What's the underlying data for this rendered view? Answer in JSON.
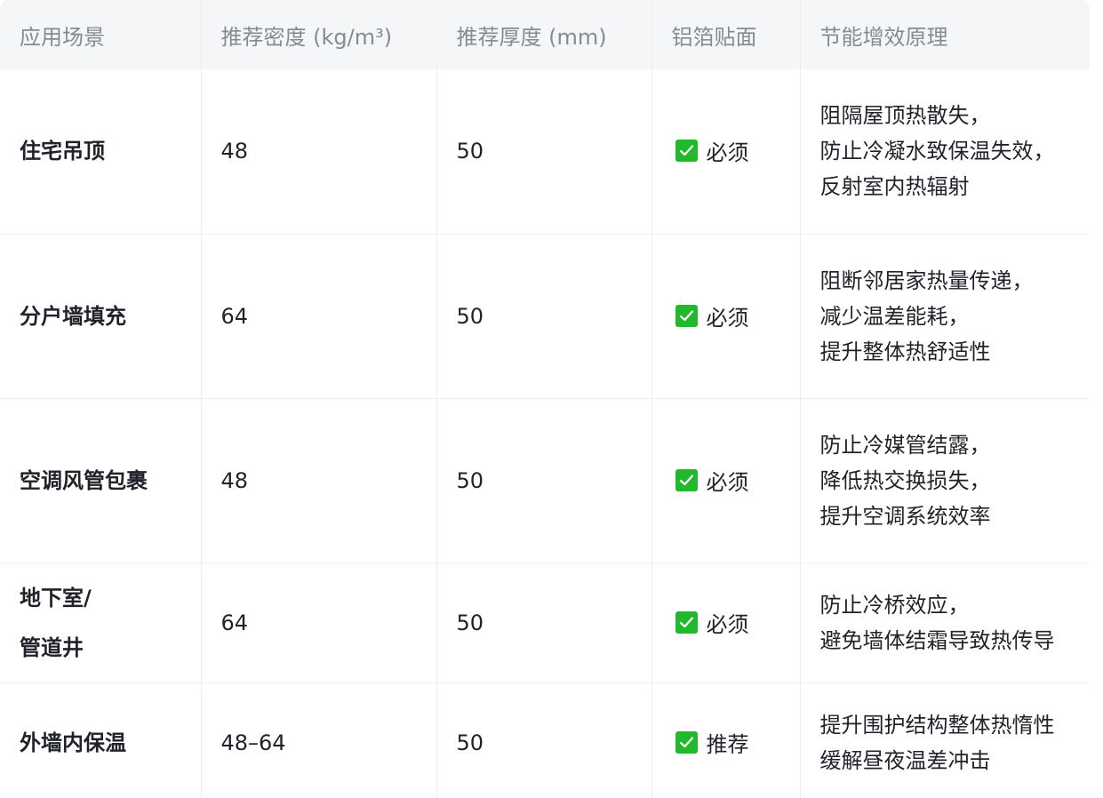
{
  "headers": {
    "scene": "应用场景",
    "density": "推荐密度 (kg/m³)",
    "thickness": "推荐厚度 (mm)",
    "foil": "铝箔贴面",
    "principle": "节能增效原理"
  },
  "rows": [
    {
      "scene": [
        "住宅吊顶"
      ],
      "density": "48",
      "thickness": "50",
      "foil": "必须",
      "principle": [
        "阻隔屋顶热散失，",
        "防止冷凝水致保温失效，",
        "反射室内热辐射"
      ]
    },
    {
      "scene": [
        "分户墙填充"
      ],
      "density": "64",
      "thickness": "50",
      "foil": "必须",
      "principle": [
        "阻断邻居家热量传递，",
        "减少温差能耗，",
        "提升整体热舒适性"
      ]
    },
    {
      "scene": [
        "空调风管包裹"
      ],
      "density": "48",
      "thickness": "50",
      "foil": "必须",
      "principle": [
        "防止冷媒管结露，",
        "降低热交换损失，",
        "提升空调系统效率"
      ]
    },
    {
      "scene": [
        "地下室/",
        "管道井"
      ],
      "density": "64",
      "thickness": "50",
      "foil": "必须",
      "principle": [
        "防止冷桥效应，",
        "避免墙体结霜导致热传导"
      ]
    },
    {
      "scene": [
        "外墙内保温"
      ],
      "density": "48–64",
      "thickness": "50",
      "foil": "推荐",
      "principle": [
        "提升围护结构整体热惰性",
        "缓解昼夜温差冲击"
      ]
    }
  ],
  "icons": {
    "foil_check": "check-box-icon"
  },
  "colors": {
    "check_green": "#22b82c",
    "header_bg": "#f5f6f8",
    "header_text": "#858b94"
  }
}
